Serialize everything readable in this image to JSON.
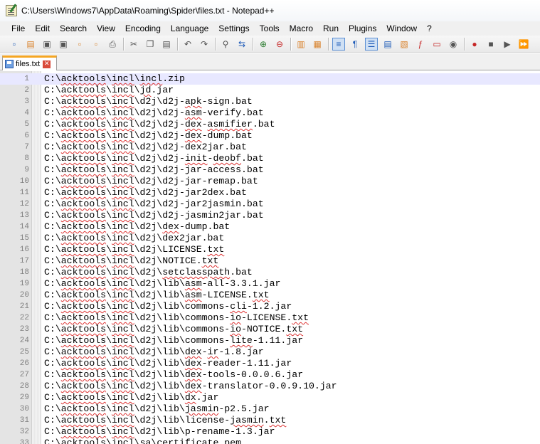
{
  "window": {
    "title": "C:\\Users\\Windows7\\AppData\\Roaming\\Spider\\files.txt - Notepad++"
  },
  "menu": [
    "File",
    "Edit",
    "Search",
    "View",
    "Encoding",
    "Language",
    "Settings",
    "Tools",
    "Macro",
    "Run",
    "Plugins",
    "Window",
    "?"
  ],
  "toolbar": {
    "buttons": [
      {
        "name": "new-file-icon",
        "glyph": "▫",
        "color": "blue"
      },
      {
        "name": "open-file-icon",
        "glyph": "▤",
        "color": "orange"
      },
      {
        "name": "save-icon",
        "glyph": "▣",
        "color": "gray"
      },
      {
        "name": "save-all-icon",
        "glyph": "▣",
        "color": "gray"
      },
      {
        "name": "close-icon",
        "glyph": "▫",
        "color": "orange"
      },
      {
        "name": "close-all-icon",
        "glyph": "▫",
        "color": "orange"
      },
      {
        "name": "print-icon",
        "glyph": "⎙",
        "color": "gray"
      },
      {
        "sep": true
      },
      {
        "name": "cut-icon",
        "glyph": "✂",
        "color": "gray"
      },
      {
        "name": "copy-icon",
        "glyph": "❐",
        "color": "gray"
      },
      {
        "name": "paste-icon",
        "glyph": "▤",
        "color": "gray"
      },
      {
        "sep": true
      },
      {
        "name": "undo-icon",
        "glyph": "↶",
        "color": "gray"
      },
      {
        "name": "redo-icon",
        "glyph": "↷",
        "color": "gray"
      },
      {
        "sep": true
      },
      {
        "name": "find-icon",
        "glyph": "⚲",
        "color": "gray"
      },
      {
        "name": "replace-icon",
        "glyph": "⇆",
        "color": "blue"
      },
      {
        "sep": true
      },
      {
        "name": "zoom-in-icon",
        "glyph": "⊕",
        "color": "green"
      },
      {
        "name": "zoom-out-icon",
        "glyph": "⊖",
        "color": "red"
      },
      {
        "sep": true
      },
      {
        "name": "sync-vertical-icon",
        "glyph": "▥",
        "color": "orange"
      },
      {
        "name": "sync-horizontal-icon",
        "glyph": "▦",
        "color": "orange"
      },
      {
        "sep": true
      },
      {
        "name": "word-wrap-icon",
        "glyph": "≡",
        "color": "blue",
        "pressed": true
      },
      {
        "name": "show-all-characters-icon",
        "glyph": "¶",
        "color": "blue"
      },
      {
        "name": "indent-guide-icon",
        "glyph": "☰",
        "color": "blue",
        "pressed": true
      },
      {
        "name": "user-language-icon",
        "glyph": "▤",
        "color": "blue"
      },
      {
        "name": "doc-map-icon",
        "glyph": "▧",
        "color": "orange"
      },
      {
        "name": "function-list-icon",
        "glyph": "ƒ",
        "color": "red"
      },
      {
        "name": "folder-workspace-icon",
        "glyph": "▭",
        "color": "red"
      },
      {
        "name": "monitoring-icon",
        "glyph": "◉",
        "color": "gray"
      },
      {
        "sep": true
      },
      {
        "name": "record-macro-icon",
        "glyph": "●",
        "color": "red"
      },
      {
        "name": "stop-macro-icon",
        "glyph": "■",
        "color": "gray"
      },
      {
        "name": "play-macro-icon",
        "glyph": "▶",
        "color": "gray"
      },
      {
        "name": "play-macro-multiple-icon",
        "glyph": "⏩",
        "color": "blue"
      }
    ]
  },
  "tabs": [
    {
      "label": "files.txt"
    }
  ],
  "editor": {
    "current_line": 1,
    "lines": [
      [
        "C:\\",
        {
          "s": "acktools"
        },
        "\\",
        {
          "s": "incl"
        },
        "\\",
        {
          "s": "incl"
        },
        ".zip"
      ],
      [
        "C:\\",
        {
          "s": "acktools"
        },
        "\\",
        {
          "s": "incl"
        },
        "\\",
        {
          "s": "jd"
        },
        ".jar"
      ],
      [
        "C:\\",
        {
          "s": "acktools"
        },
        "\\",
        {
          "s": "incl"
        },
        "\\d2j\\d2j-",
        {
          "s": "apk"
        },
        "-sign.bat"
      ],
      [
        "C:\\",
        {
          "s": "acktools"
        },
        "\\",
        {
          "s": "incl"
        },
        "\\d2j\\d2j-",
        {
          "s": "asm"
        },
        "-verify.bat"
      ],
      [
        "C:\\",
        {
          "s": "acktools"
        },
        "\\",
        {
          "s": "incl"
        },
        "\\d2j\\d2j-",
        {
          "s": "dex"
        },
        "-",
        {
          "s": "asmifier"
        },
        ".bat"
      ],
      [
        "C:\\",
        {
          "s": "acktools"
        },
        "\\",
        {
          "s": "incl"
        },
        "\\d2j\\d2j-",
        {
          "s": "dex"
        },
        "-dump.bat"
      ],
      [
        "C:\\",
        {
          "s": "acktools"
        },
        "\\",
        {
          "s": "incl"
        },
        "\\d2j\\d2j-dex2jar.bat"
      ],
      [
        "C:\\",
        {
          "s": "acktools"
        },
        "\\",
        {
          "s": "incl"
        },
        "\\d2j\\d2j-",
        {
          "s": "init"
        },
        "-",
        {
          "s": "deobf"
        },
        ".bat"
      ],
      [
        "C:\\",
        {
          "s": "acktools"
        },
        "\\",
        {
          "s": "incl"
        },
        "\\d2j\\d2j-jar-access.bat"
      ],
      [
        "C:\\",
        {
          "s": "acktools"
        },
        "\\",
        {
          "s": "incl"
        },
        "\\d2j\\d2j-jar-remap.bat"
      ],
      [
        "C:\\",
        {
          "s": "acktools"
        },
        "\\",
        {
          "s": "incl"
        },
        "\\d2j\\d2j-jar2dex.bat"
      ],
      [
        "C:\\",
        {
          "s": "acktools"
        },
        "\\",
        {
          "s": "incl"
        },
        "\\d2j\\d2j-jar2jasmin.bat"
      ],
      [
        "C:\\",
        {
          "s": "acktools"
        },
        "\\",
        {
          "s": "incl"
        },
        "\\d2j\\d2j-jasmin2jar.bat"
      ],
      [
        "C:\\",
        {
          "s": "acktools"
        },
        "\\",
        {
          "s": "incl"
        },
        "\\d2j\\",
        {
          "s": "dex"
        },
        "-dump.bat"
      ],
      [
        "C:\\",
        {
          "s": "acktools"
        },
        "\\",
        {
          "s": "incl"
        },
        "\\d2j\\dex2jar.bat"
      ],
      [
        "C:\\",
        {
          "s": "acktools"
        },
        "\\",
        {
          "s": "incl"
        },
        "\\d2j\\LICENSE.",
        {
          "s": "txt"
        }
      ],
      [
        "C:\\",
        {
          "s": "acktools"
        },
        "\\",
        {
          "s": "incl"
        },
        "\\d2j\\NOTICE.",
        {
          "s": "txt"
        }
      ],
      [
        "C:\\",
        {
          "s": "acktools"
        },
        "\\",
        {
          "s": "incl"
        },
        "\\d2j\\",
        {
          "s": "setclasspath"
        },
        ".bat"
      ],
      [
        "C:\\",
        {
          "s": "acktools"
        },
        "\\",
        {
          "s": "incl"
        },
        "\\d2j\\lib\\",
        {
          "s": "asm"
        },
        "-all-3.3.1.jar"
      ],
      [
        "C:\\",
        {
          "s": "acktools"
        },
        "\\",
        {
          "s": "incl"
        },
        "\\d2j\\lib\\",
        {
          "s": "asm"
        },
        "-LICENSE.",
        {
          "s": "txt"
        }
      ],
      [
        "C:\\",
        {
          "s": "acktools"
        },
        "\\",
        {
          "s": "incl"
        },
        "\\d2j\\lib\\commons-",
        {
          "s": "cli"
        },
        "-1.2.jar"
      ],
      [
        "C:\\",
        {
          "s": "acktools"
        },
        "\\",
        {
          "s": "incl"
        },
        "\\d2j\\lib\\commons-",
        {
          "s": "io"
        },
        "-LICENSE.",
        {
          "s": "txt"
        }
      ],
      [
        "C:\\",
        {
          "s": "acktools"
        },
        "\\",
        {
          "s": "incl"
        },
        "\\d2j\\lib\\commons-",
        {
          "s": "io"
        },
        "-NOTICE.",
        {
          "s": "txt"
        }
      ],
      [
        "C:\\",
        {
          "s": "acktools"
        },
        "\\",
        {
          "s": "incl"
        },
        "\\d2j\\lib\\commons-",
        {
          "s": "lite"
        },
        "-1.11.jar"
      ],
      [
        "C:\\",
        {
          "s": "acktools"
        },
        "\\",
        {
          "s": "incl"
        },
        "\\d2j\\lib\\",
        {
          "s": "dex"
        },
        "-",
        {
          "s": "ir"
        },
        "-1.8.jar"
      ],
      [
        "C:\\",
        {
          "s": "acktools"
        },
        "\\",
        {
          "s": "incl"
        },
        "\\d2j\\lib\\",
        {
          "s": "dex"
        },
        "-reader-1.11.jar"
      ],
      [
        "C:\\",
        {
          "s": "acktools"
        },
        "\\",
        {
          "s": "incl"
        },
        "\\d2j\\lib\\",
        {
          "s": "dex"
        },
        "-tools-0.0.0.6.jar"
      ],
      [
        "C:\\",
        {
          "s": "acktools"
        },
        "\\",
        {
          "s": "incl"
        },
        "\\d2j\\lib\\",
        {
          "s": "dex"
        },
        "-translator-0.0.9.10.jar"
      ],
      [
        "C:\\",
        {
          "s": "acktools"
        },
        "\\",
        {
          "s": "incl"
        },
        "\\d2j\\lib\\",
        {
          "s": "dx"
        },
        ".jar"
      ],
      [
        "C:\\",
        {
          "s": "acktools"
        },
        "\\",
        {
          "s": "incl"
        },
        "\\d2j\\lib\\",
        {
          "s": "jasmin"
        },
        "-p2.5.jar"
      ],
      [
        "C:\\",
        {
          "s": "acktools"
        },
        "\\",
        {
          "s": "incl"
        },
        "\\d2j\\lib\\license-",
        {
          "s": "jasmin"
        },
        ".",
        {
          "s": "txt"
        }
      ],
      [
        "C:\\",
        {
          "s": "acktools"
        },
        "\\",
        {
          "s": "incl"
        },
        "\\d2j\\lib\\p-rename-1.3.jar"
      ],
      [
        "C:\\",
        {
          "s": "acktools"
        },
        "\\",
        {
          "s": "incl"
        },
        "\\",
        {
          "s": "sa"
        },
        "\\",
        {
          "s": "certificate"
        },
        ".",
        {
          "s": "pem"
        }
      ]
    ]
  }
}
